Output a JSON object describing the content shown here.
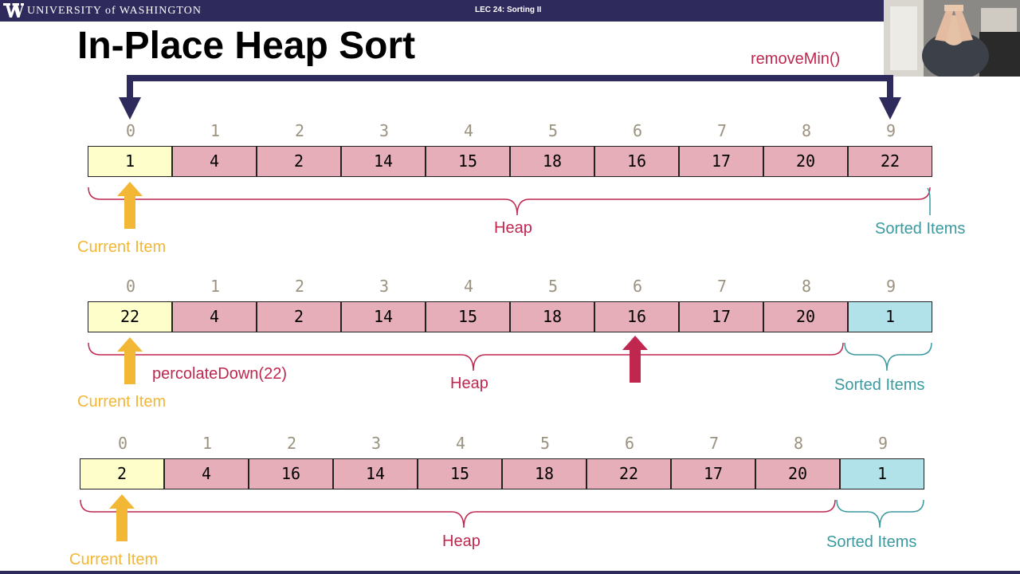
{
  "header": {
    "university": "UNIVERSITY of WASHINGTON",
    "lecture": "LEC 24: Sorting II"
  },
  "slide": {
    "title": "In-Place Heap Sort",
    "remove_min_label": "removeMin()",
    "percolate_label": "percolateDown(22)",
    "rows": [
      {
        "indices": [
          "0",
          "1",
          "2",
          "3",
          "4",
          "5",
          "6",
          "7",
          "8",
          "9"
        ],
        "values": [
          "1",
          "4",
          "2",
          "14",
          "15",
          "18",
          "16",
          "17",
          "20",
          "22"
        ],
        "heap_label": "Heap",
        "sorted_label": "Sorted Items",
        "current_label": "Current Item"
      },
      {
        "indices": [
          "0",
          "1",
          "2",
          "3",
          "4",
          "5",
          "6",
          "7",
          "8",
          "9"
        ],
        "values": [
          "22",
          "4",
          "2",
          "14",
          "15",
          "18",
          "16",
          "17",
          "20",
          "1"
        ],
        "heap_label": "Heap",
        "sorted_label": "Sorted Items",
        "current_label": "Current Item"
      },
      {
        "indices": [
          "0",
          "1",
          "2",
          "3",
          "4",
          "5",
          "6",
          "7",
          "8",
          "9"
        ],
        "values": [
          "2",
          "4",
          "16",
          "14",
          "15",
          "18",
          "22",
          "17",
          "20",
          "1"
        ],
        "heap_label": "Heap",
        "sorted_label": "Sorted Items",
        "current_label": "Current Item"
      }
    ]
  },
  "colors": {
    "bar": "#2e2a5c",
    "current_cell": "#fefecb",
    "heap_cell": "#e6aeb9",
    "sorted_cell": "#b1e1e9",
    "heap_accent": "#c0274f",
    "current_arrow": "#f2b735",
    "sorted_accent": "#3a9aa0"
  },
  "icons": [
    "uw-logo-icon",
    "down-arrow-icon",
    "up-arrow-icon"
  ]
}
